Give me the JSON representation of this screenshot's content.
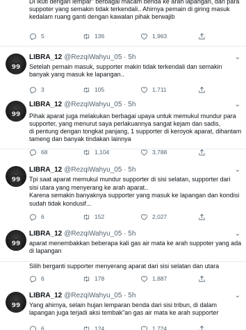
{
  "tweets": [
    {
      "name": "",
      "handle": "",
      "time": "",
      "avatar_num": "",
      "lines": [
        "Di ikuti dengan lempar\" berbagai macam benda ke arah lapangan, dan para",
        "suppoter yang semakin tidak terkendali.. Ahirnya pemain di giring masuk",
        "kedalam ruang ganti dengan kawalan pihak berwajib"
      ],
      "reply": "5",
      "retweet": "136",
      "like": "1,963"
    },
    {
      "name": "LIBRA_12",
      "handle": "@RezqiWahyu_05 · 5h",
      "time": "",
      "avatar_num": "99",
      "lines": [
        "Setelah pemain masuk, supporter makin tidak terkendali dan semakin",
        "banyak yang masuk ke lapangan.."
      ],
      "reply": "3",
      "retweet": "105",
      "like": "1,711"
    },
    {
      "name": "LIBRA_12",
      "handle": "@RezqiWahyu_05 · 5h",
      "time": "",
      "avatar_num": "99",
      "lines": [
        "Pihak aparat juga melakukan berbagai upaya untuk memukul mundur para",
        "supporter, yang menurut saya perlakuannya sangat kejam dan sadis,",
        "di pentung dengan tongkat panjang, 1 supporter di keroyok aparat, dihantam",
        "tameng dan banyak tindakan lainnya"
      ],
      "reply": "68",
      "retweet": "1,104",
      "like": "3,788"
    },
    {
      "name": "LIBRA_12",
      "handle": "@RezqiWahyu_05 · 5h",
      "time": "",
      "avatar_num": "99",
      "lines": [
        "Tpi saat aparat memukul mundur supporter di sisi selatan, supporter dari",
        "sisi utara yang menyerang ke arah aparat..",
        "Karena semakin banyaknya supporter yang masuk ke lapangan dan kondisi",
        "sudah tidak kondusif..."
      ],
      "reply": "6",
      "retweet": "152",
      "like": "2,027"
    },
    {
      "name": "LIBRA_12",
      "handle": "@RezqiWahyu_05 · 5h",
      "time": "",
      "avatar_num": "99",
      "lines": [
        "aparat menembakkan beberapa kali gas air mata ke arah suppoter yang ada",
        "di lapangan",
        "",
        "Silih berganti supporter menyerang aparat dari sisi selatan dan utara"
      ],
      "reply": "6",
      "retweet": "178",
      "like": "1,887"
    },
    {
      "name": "LIBRA_12",
      "handle": "@RezqiWahyu_05 · 5h",
      "time": "",
      "avatar_num": "99",
      "lines": [
        "Yang ahirnya, selain hujan lemparan benda dari sisi tribun, di dalam",
        "lapangan juga terjadi aksi tembak\"an gas air mata ke arah supporter"
      ],
      "reply": "6",
      "retweet": "124",
      "like": "1,724"
    }
  ],
  "icons": {
    "reply": "reply-icon",
    "retweet": "retweet-icon",
    "like": "like-icon",
    "share": "share-icon",
    "more": "more-caret-icon"
  },
  "colors": {
    "text": "#0f1419",
    "muted": "#536471",
    "divider": "#e6ecf0"
  }
}
